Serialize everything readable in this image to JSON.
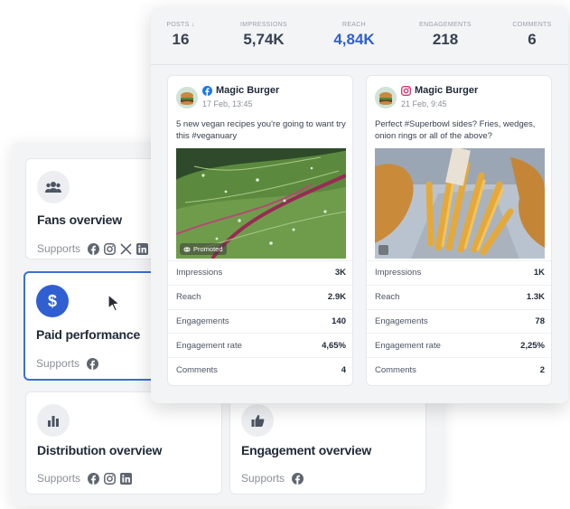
{
  "report_cards": [
    {
      "title": "Fans overview",
      "supports_label": "Supports",
      "icon": "people-icon",
      "networks": [
        "facebook-icon",
        "instagram-icon",
        "x-icon",
        "linkedin-icon"
      ]
    },
    {
      "title": "Paid performance",
      "supports_label": "Supports",
      "icon": "dollar-icon",
      "networks": [
        "facebook-icon"
      ],
      "selected": true
    },
    {
      "title": "Distribution overview",
      "supports_label": "Supports",
      "icon": "bar-chart-icon",
      "networks": [
        "facebook-icon",
        "instagram-icon",
        "linkedin-icon"
      ]
    },
    {
      "title": "Engagement overview",
      "supports_label": "Supports",
      "icon": "thumbs-up-icon",
      "networks": [
        "facebook-icon"
      ]
    }
  ],
  "stats": [
    {
      "label": "POSTS",
      "sort_indicator": "↓",
      "value": "16"
    },
    {
      "label": "IMPRESSIONS",
      "value": "5,74K"
    },
    {
      "label": "REACH",
      "value": "4,84K",
      "highlight": true
    },
    {
      "label": "ENGAGEMENTS",
      "value": "218"
    },
    {
      "label": "COMMENTS",
      "value": "6"
    }
  ],
  "posts": [
    {
      "network": "facebook",
      "brand": "Magic Burger",
      "date": "17 Feb, 13:45",
      "caption": "5 new vegan recipes you're going to want try this #veganuary",
      "badge": "Promoted",
      "metrics": [
        {
          "name": "Impressions",
          "value": "3K"
        },
        {
          "name": "Reach",
          "value": "2.9K"
        },
        {
          "name": "Engagements",
          "value": "140"
        },
        {
          "name": "Engagement rate",
          "value": "4,65%"
        },
        {
          "name": "Comments",
          "value": "4"
        }
      ]
    },
    {
      "network": "instagram",
      "brand": "Magic Burger",
      "date": "21 Feb, 9:45",
      "caption": "Perfect #Superbowl sides? Fries, wedges, onion rings or all of the above?",
      "metrics": [
        {
          "name": "Impressions",
          "value": "1K"
        },
        {
          "name": "Reach",
          "value": "1.3K"
        },
        {
          "name": "Engagements",
          "value": "78"
        },
        {
          "name": "Engagement rate",
          "value": "2,25%"
        },
        {
          "name": "Comments",
          "value": "2"
        }
      ]
    }
  ],
  "colors": {
    "accent": "#2f5fd0",
    "facebook": "#1877f2",
    "instagram": "#d6336c"
  }
}
